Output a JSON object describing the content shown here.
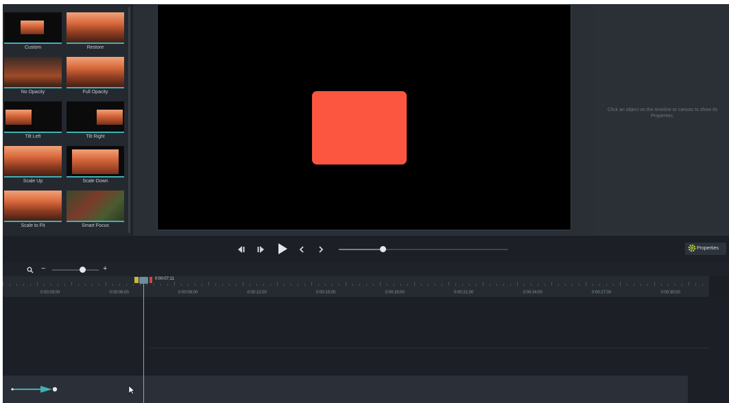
{
  "presets": [
    {
      "label": "Custom"
    },
    {
      "label": "Restore"
    },
    {
      "label": "No Opacity"
    },
    {
      "label": "Full Opacity"
    },
    {
      "label": "Tilt Left"
    },
    {
      "label": "Tilt Right"
    },
    {
      "label": "Scale Up"
    },
    {
      "label": "Scale Down"
    },
    {
      "label": "Scale to Fit"
    },
    {
      "label": "Smart Focus"
    }
  ],
  "canvas": {
    "shape_color": "#fd5640",
    "background": "#000000"
  },
  "properties_panel": {
    "message": "Click an object on the timeline or canvas to show its Properties.",
    "button_label": "Properties",
    "button_icon": "gear-icon"
  },
  "playback": {
    "controls": [
      "step-back-icon",
      "step-forward-icon",
      "play-icon",
      "previous-marker-icon",
      "next-marker-icon"
    ],
    "scrub_position": 0.26
  },
  "timeline": {
    "zoom_icon": "search-icon",
    "zoom_out": "−",
    "zoom_in": "+",
    "zoom_level": 0.65,
    "playhead_time": "0:00:07;11",
    "ruler_labels": [
      "0:00:03;00",
      "0:00:06;00",
      "0:00:09;00",
      "0:00:12;00",
      "0:00:15;00",
      "0:00:18;00",
      "0:00:21;00",
      "0:00:24;00",
      "0:00:27;00",
      "0:00:30;00"
    ]
  },
  "colors": {
    "accent": "#3fb2b6",
    "properties_gear": "#c6d83a",
    "playhead_red": "#d8443a"
  }
}
